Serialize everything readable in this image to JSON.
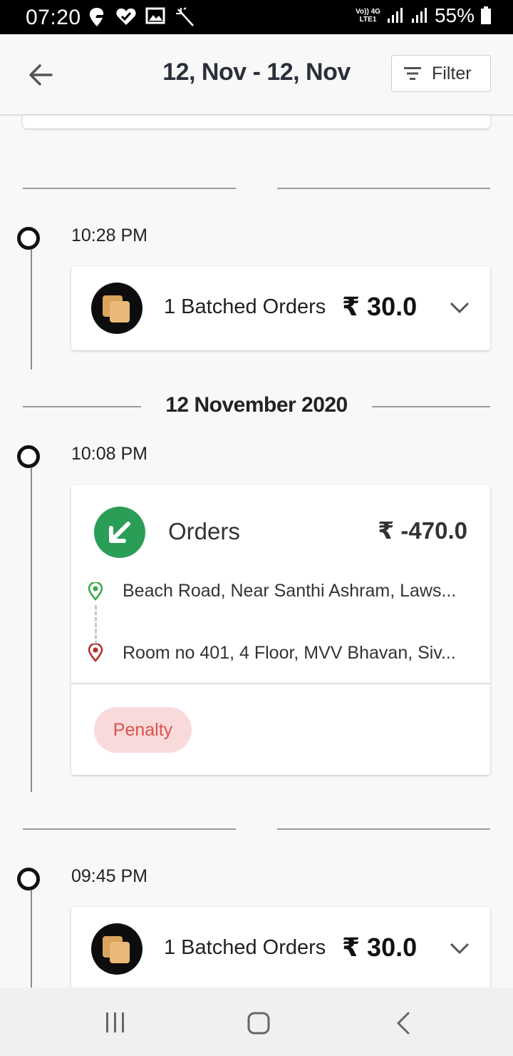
{
  "status_bar": {
    "time": "07:20",
    "network_top": "Vo)) 4G",
    "network_bottom": "LTE1",
    "battery": "55%"
  },
  "app_bar": {
    "title": "12, Nov - 12, Nov",
    "filter_label": "Filter"
  },
  "timeline": {
    "date_header": "12 November 2020",
    "entries": [
      {
        "time": "10:28 PM",
        "label": "1 Batched Orders",
        "amount": "₹ 30.0"
      },
      {
        "time": "10:08 PM",
        "title": "Orders",
        "amount": "₹ -470.0",
        "pickup": "Beach Road, Near Santhi Ashram, Laws...",
        "drop": "Room no 401, 4 Floor, MVV Bhavan, Siv...",
        "tag": "Penalty"
      },
      {
        "time": "09:45 PM",
        "label": "1 Batched Orders",
        "amount": "₹ 30.0"
      }
    ]
  },
  "colors": {
    "order_icon_bg": "#2a9d57",
    "penalty_bg": "#f9dada",
    "penalty_text": "#d9534f",
    "batch_icon": "#e8b56f"
  }
}
